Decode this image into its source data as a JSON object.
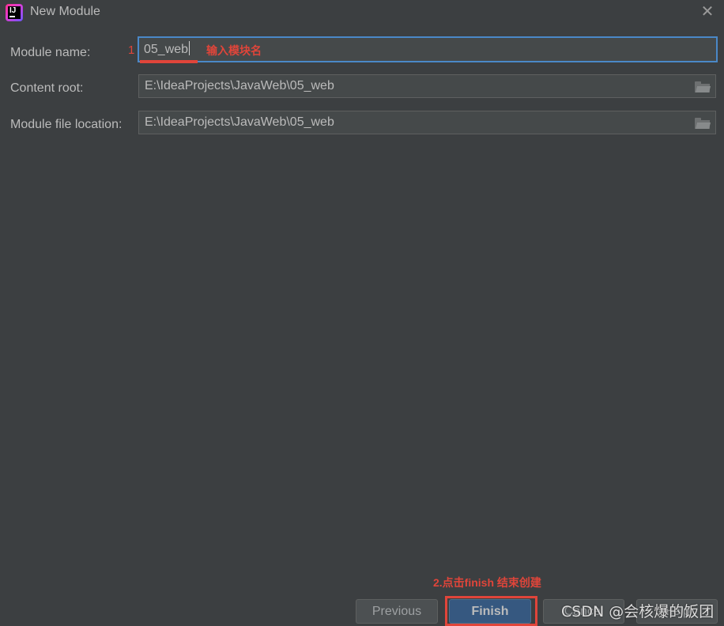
{
  "window": {
    "title": "New Module",
    "app_icon": "intellij-idea-icon",
    "close_icon": "close-icon"
  },
  "form": {
    "module_name": {
      "label": "Module name:",
      "value": "05_web"
    },
    "content_root": {
      "label": "Content root:",
      "value": "E:\\IdeaProjects\\JavaWeb\\05_web",
      "browse_icon": "folder-icon"
    },
    "module_file_location": {
      "label": "Module file location:",
      "value": "E:\\IdeaProjects\\JavaWeb\\05_web",
      "browse_icon": "folder-icon"
    }
  },
  "annotations": {
    "step1_number": "1",
    "step1_text": "输入模块名",
    "step2_text": "2.点击finish 结束创建",
    "color": "#e0453a"
  },
  "buttons": {
    "previous": "Previous",
    "finish": "Finish",
    "cancel": "Cancel",
    "help": "Help"
  },
  "watermark": "CSDN @会核爆的饭团",
  "colors": {
    "background": "#3c3f41",
    "field_bg": "#45494a",
    "focus_border": "#4a88c7",
    "primary_button": "#365880"
  }
}
